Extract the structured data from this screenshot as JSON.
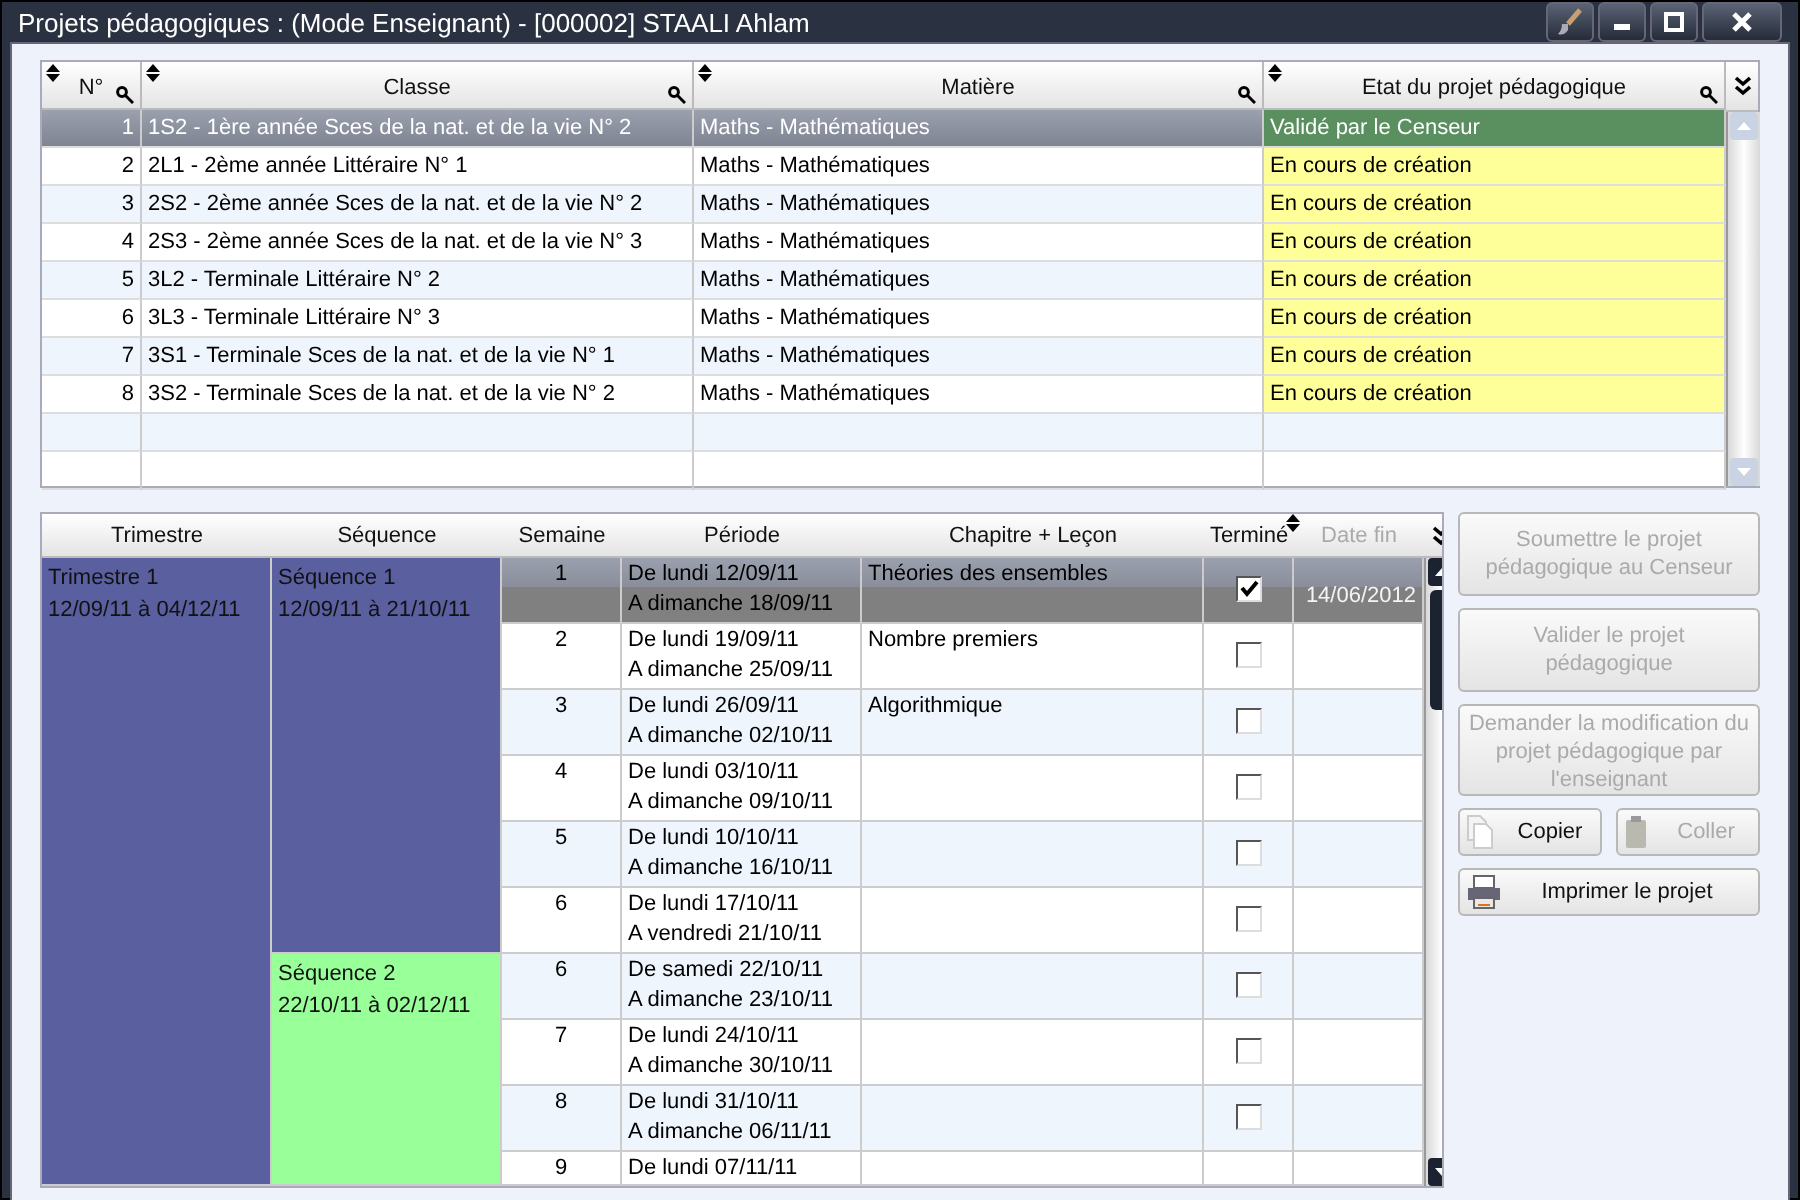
{
  "window": {
    "title": "Projets pédagogiques : (Mode Enseignant) - [000002] STAALI Ahlam"
  },
  "projects": {
    "columns": [
      "N°",
      "Classe",
      "Matière",
      "Etat du projet pédagogique"
    ],
    "rows": [
      {
        "n": "1",
        "classe": "1S2 - 1ère année Sces de la nat. et de la vie N° 2",
        "matiere": "Maths - Mathématiques",
        "status": "Validé par le Censeur",
        "color": "#5a8f5f",
        "selected": true
      },
      {
        "n": "2",
        "classe": "2L1 - 2ème année Littéraire N° 1",
        "matiere": "Maths - Mathématiques",
        "status": "En cours de création",
        "color": "#ffff99",
        "selected": false
      },
      {
        "n": "3",
        "classe": "2S2 - 2ème année Sces de la nat. et de la vie N° 2",
        "matiere": "Maths - Mathématiques",
        "status": "En cours de création",
        "color": "#ffff99",
        "selected": false
      },
      {
        "n": "4",
        "classe": "2S3 - 2ème année Sces de la nat. et de la vie N° 3",
        "matiere": "Maths - Mathématiques",
        "status": "En cours de création",
        "color": "#ffff99",
        "selected": false
      },
      {
        "n": "5",
        "classe": "3L2 - Terminale Littéraire N° 2",
        "matiere": "Maths - Mathématiques",
        "status": "En cours de création",
        "color": "#ffff99",
        "selected": false
      },
      {
        "n": "6",
        "classe": "3L3 - Terminale Littéraire N° 3",
        "matiere": "Maths - Mathématiques",
        "status": "En cours de création",
        "color": "#ffff99",
        "selected": false
      },
      {
        "n": "7",
        "classe": "3S1 - Terminale Sces de la nat. et de la vie N° 1",
        "matiere": "Maths - Mathématiques",
        "status": "En cours de création",
        "color": "#ffff99",
        "selected": false
      },
      {
        "n": "8",
        "classe": "3S2 - Terminale Sces de la nat. et de la vie N° 2",
        "matiere": "Maths - Mathématiques",
        "status": "En cours de création",
        "color": "#ffff99",
        "selected": false
      }
    ]
  },
  "plan": {
    "columns": [
      "Trimestre",
      "Séquence",
      "Semaine",
      "Période",
      "Chapitre + Leçon",
      "Terminé",
      "Date fin"
    ],
    "trimesters": [
      {
        "title": "Trimestre 1",
        "dates": "12/09/11 à 04/12/11",
        "color": "#5a5f9f",
        "sequences": [
          {
            "title": "Séquence 1",
            "dates": "12/09/11 à 21/10/11",
            "color": "#5a5f9f",
            "weeks": [
              {
                "week": "1",
                "from": "De lundi 12/09/11",
                "to": "A dimanche 18/09/11",
                "chapter": "Théories des ensembles",
                "done": true,
                "date_end": "14/06/2012",
                "selected": true
              },
              {
                "week": "2",
                "from": "De lundi 19/09/11",
                "to": "A dimanche 25/09/11",
                "chapter": "Nombre premiers",
                "done": false,
                "selected": false
              },
              {
                "week": "3",
                "from": "De lundi 26/09/11",
                "to": "A dimanche 02/10/11",
                "chapter": "Algorithmique",
                "done": false,
                "selected": false
              },
              {
                "week": "4",
                "from": "De lundi 03/10/11",
                "to": "A dimanche 09/10/11",
                "done": false,
                "selected": false
              },
              {
                "week": "5",
                "from": "De lundi 10/10/11",
                "to": "A dimanche 16/10/11",
                "done": false,
                "selected": false
              },
              {
                "week": "6",
                "from": "De lundi 17/10/11",
                "to": "A vendredi 21/10/11",
                "done": false,
                "selected": false
              }
            ]
          },
          {
            "title": "Séquence 2",
            "dates": "22/10/11 à 02/12/11",
            "color": "#99ff99",
            "weeks": [
              {
                "week": "6",
                "from": "De samedi 22/10/11",
                "to": "A dimanche 23/10/11",
                "done": false,
                "selected": false
              },
              {
                "week": "7",
                "from": "De lundi 24/10/11",
                "to": "A dimanche 30/10/11",
                "done": false,
                "selected": false
              },
              {
                "week": "8",
                "from": "De lundi 31/10/11",
                "to": "A dimanche 06/11/11",
                "done": false,
                "selected": false
              },
              {
                "week": "9",
                "from": "De lundi 07/11/11",
                "selected": false
              }
            ]
          }
        ]
      }
    ]
  },
  "actions": [
    {
      "kind": "text",
      "label": "Soumettre le projet pédagogique au Censeur",
      "disabled": true
    },
    {
      "kind": "text",
      "label": "Valider le projet pédagogique",
      "disabled": true
    },
    {
      "kind": "text",
      "label": "Demander la modification du projet pédagogique par l'enseignant",
      "disabled": true
    },
    {
      "kind": "copy",
      "label": "Copier",
      "disabled": false
    },
    {
      "kind": "paste",
      "label": "Coller",
      "disabled": true
    },
    {
      "kind": "print",
      "label": "Imprimer le projet",
      "disabled": false
    }
  ]
}
